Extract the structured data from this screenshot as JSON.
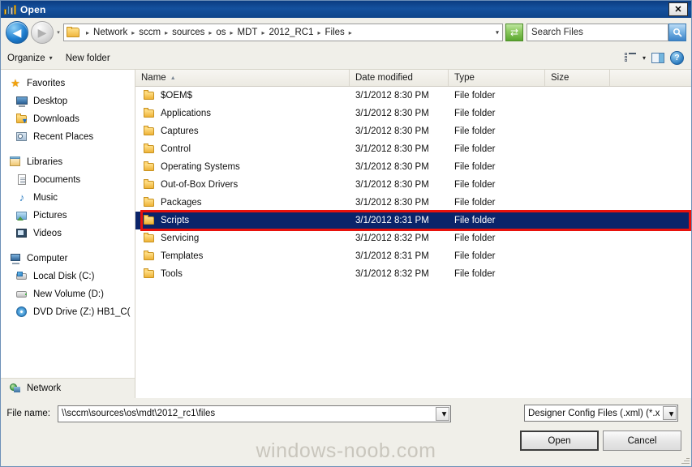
{
  "window": {
    "title": "Open",
    "close_label": "✕"
  },
  "address": {
    "back_icon": "◀",
    "forward_icon": "▶",
    "history_icon": "▾",
    "separator": "▸",
    "breadcrumbs": [
      "Network",
      "sccm",
      "sources",
      "os",
      "MDT",
      "2012_RC1",
      "Files"
    ],
    "dropdown_icon": "▾",
    "refresh_icon": "⇄",
    "search_placeholder": "Search Files",
    "search_icon": "🔍"
  },
  "commandbar": {
    "organize_label": "Organize",
    "organize_caret": "▾",
    "new_folder_label": "New folder",
    "view_caret": "▾",
    "help_label": "?"
  },
  "sidebar": {
    "groups": [
      {
        "root": {
          "label": "Favorites",
          "icon": "star-icon"
        },
        "items": [
          {
            "label": "Desktop",
            "icon": "desktop-icon"
          },
          {
            "label": "Downloads",
            "icon": "downloads-icon"
          },
          {
            "label": "Recent Places",
            "icon": "recent-places-icon"
          }
        ]
      },
      {
        "root": {
          "label": "Libraries",
          "icon": "libraries-icon"
        },
        "items": [
          {
            "label": "Documents",
            "icon": "documents-icon"
          },
          {
            "label": "Music",
            "icon": "music-icon"
          },
          {
            "label": "Pictures",
            "icon": "pictures-icon"
          },
          {
            "label": "Videos",
            "icon": "videos-icon"
          }
        ]
      },
      {
        "root": {
          "label": "Computer",
          "icon": "computer-icon"
        },
        "items": [
          {
            "label": "Local Disk (C:)",
            "icon": "local-disk-icon"
          },
          {
            "label": "New Volume (D:)",
            "icon": "drive-icon"
          },
          {
            "label": "DVD Drive (Z:) HB1_C(",
            "icon": "dvd-drive-icon"
          }
        ]
      }
    ],
    "network": {
      "label": "Network",
      "icon": "network-icon"
    }
  },
  "filelist": {
    "columns": [
      {
        "label": "Name",
        "sorted": true,
        "sort_icon": "▲"
      },
      {
        "label": "Date modified"
      },
      {
        "label": "Type"
      },
      {
        "label": "Size"
      }
    ],
    "rows": [
      {
        "name": "$OEM$",
        "date": "3/1/2012 8:30 PM",
        "type": "File folder",
        "size": "",
        "selected": false
      },
      {
        "name": "Applications",
        "date": "3/1/2012 8:30 PM",
        "type": "File folder",
        "size": "",
        "selected": false
      },
      {
        "name": "Captures",
        "date": "3/1/2012 8:30 PM",
        "type": "File folder",
        "size": "",
        "selected": false
      },
      {
        "name": "Control",
        "date": "3/1/2012 8:30 PM",
        "type": "File folder",
        "size": "",
        "selected": false
      },
      {
        "name": "Operating Systems",
        "date": "3/1/2012 8:30 PM",
        "type": "File folder",
        "size": "",
        "selected": false
      },
      {
        "name": "Out-of-Box Drivers",
        "date": "3/1/2012 8:30 PM",
        "type": "File folder",
        "size": "",
        "selected": false
      },
      {
        "name": "Packages",
        "date": "3/1/2012 8:30 PM",
        "type": "File folder",
        "size": "",
        "selected": false
      },
      {
        "name": "Scripts",
        "date": "3/1/2012 8:31 PM",
        "type": "File folder",
        "size": "",
        "selected": true
      },
      {
        "name": "Servicing",
        "date": "3/1/2012 8:32 PM",
        "type": "File folder",
        "size": "",
        "selected": false
      },
      {
        "name": "Templates",
        "date": "3/1/2012 8:31 PM",
        "type": "File folder",
        "size": "",
        "selected": false
      },
      {
        "name": "Tools",
        "date": "3/1/2012 8:32 PM",
        "type": "File folder",
        "size": "",
        "selected": false
      }
    ],
    "highlight_color": "#e8120c",
    "selection_color": "#0a246a"
  },
  "footer": {
    "filename_label": "File name:",
    "filename_value": "\\\\sccm\\sources\\os\\mdt\\2012_rc1\\files",
    "filename_dropdown_icon": "▾",
    "filetype_value": "Designer Config Files (.xml) (*.x",
    "filetype_dropdown_icon": "▾",
    "open_label": "Open",
    "cancel_label": "Cancel",
    "watermark": "windows-noob.com"
  }
}
